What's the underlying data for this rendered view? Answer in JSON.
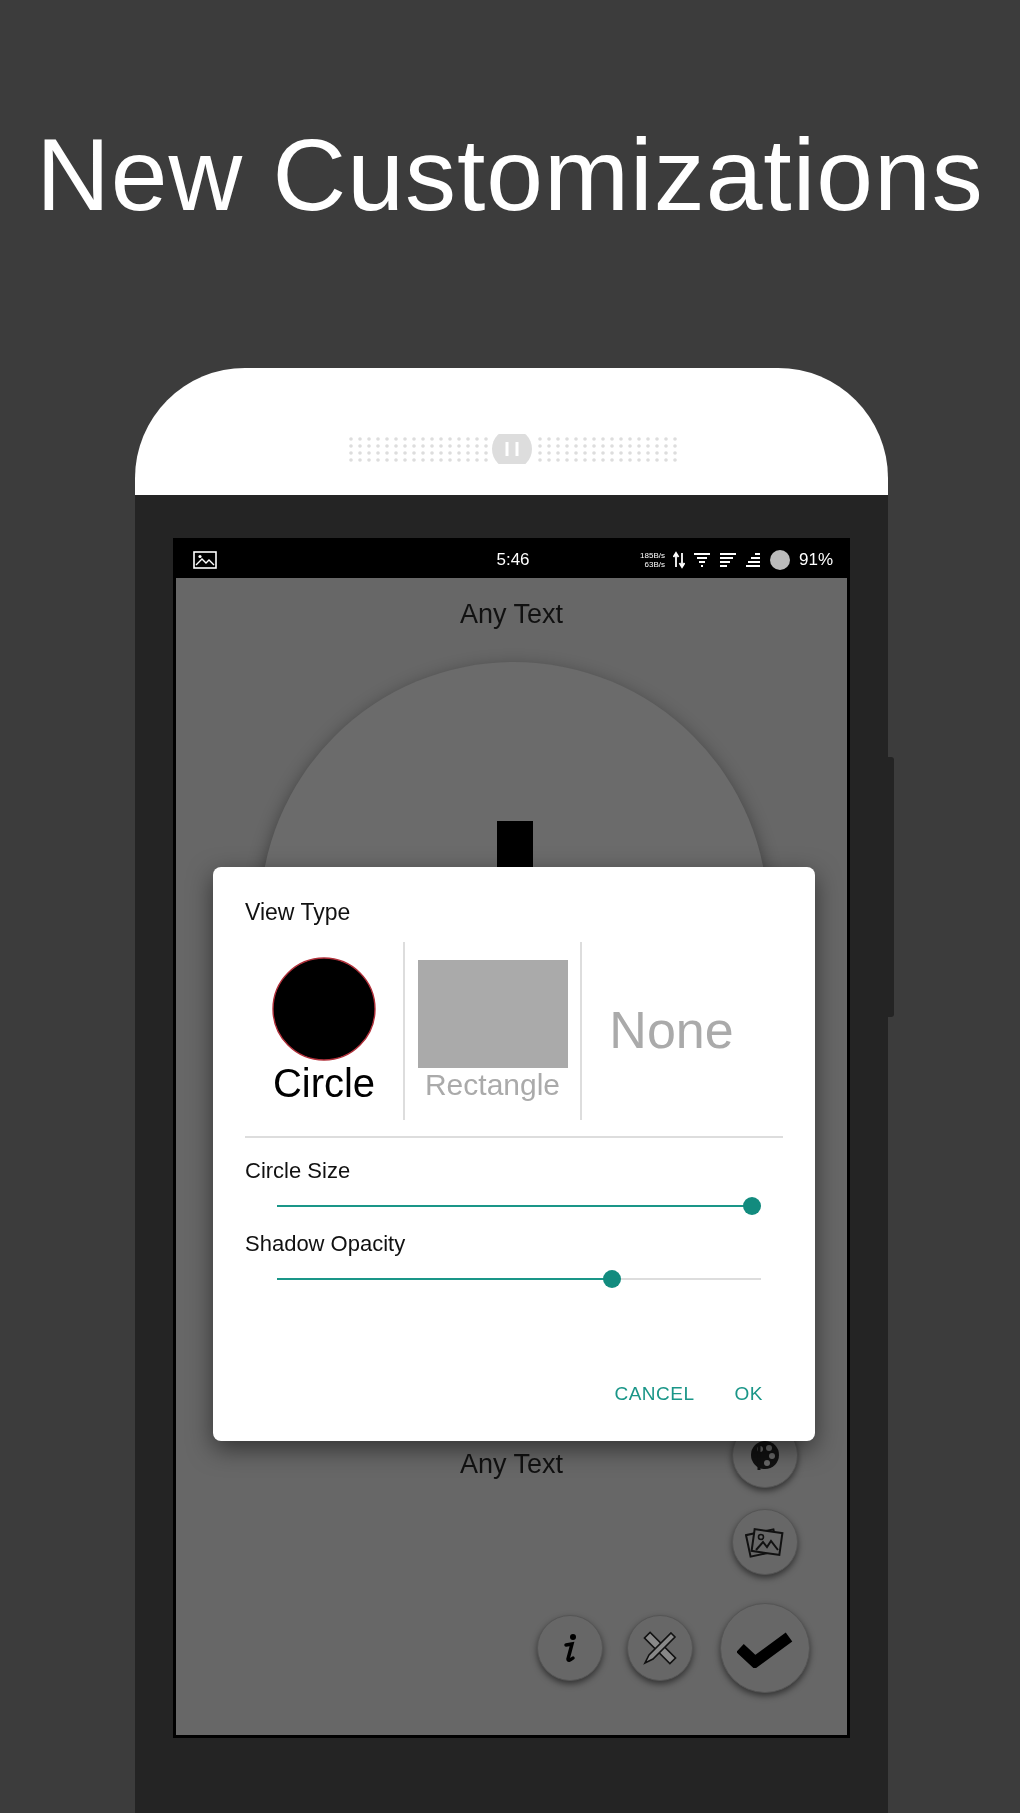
{
  "headline": "New Customizations",
  "status_bar": {
    "time": "5:46",
    "speed_up": "185B/s",
    "speed_down": "63B/s",
    "battery": "91%"
  },
  "preview": {
    "top_text": "Any Text",
    "bottom_text": "Any Text"
  },
  "dialog": {
    "title": "View Type",
    "view_types": [
      {
        "label": "Circle",
        "kind": "circle",
        "selected": true
      },
      {
        "label": "Rectangle",
        "kind": "rectangle",
        "selected": false
      },
      {
        "label": "None",
        "kind": "none",
        "selected": false
      }
    ],
    "sliders": [
      {
        "label": "Circle Size",
        "level": 1.0
      },
      {
        "label": "Shadow Opacity",
        "level": 0.7
      }
    ],
    "buttons": [
      "CANCEL",
      "OK"
    ]
  }
}
